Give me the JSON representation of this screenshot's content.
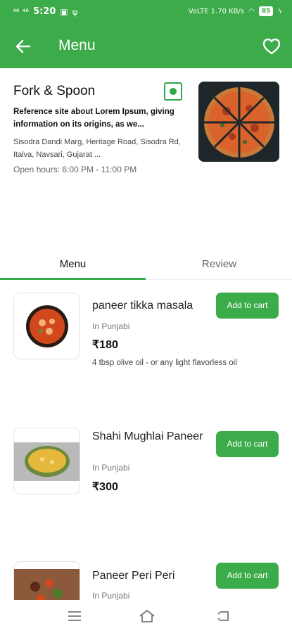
{
  "status_bar": {
    "left_icons": "⁴⁶ ⁴⁶",
    "time": "5:20",
    "right_text": "VoLTE 1.70 KB/s",
    "battery": "85",
    "colors": {
      "bg": "#3cab49"
    }
  },
  "app_bar": {
    "back_icon": "arrow-left-icon",
    "title": "Menu",
    "favorite_icon": "heart-outline-icon"
  },
  "restaurant": {
    "name": "Fork & Spoon",
    "veg_indicator": "veg-icon",
    "description": "Reference site about Lorem Ipsum, giving information on its origins, as we...",
    "address": "Sisodra Dandi Marg, Heritage Road, Sisodra Rd, Italva, Navsari, Gujarat ...",
    "hours": "Open hours: 6:00 PM - 11:00 PM"
  },
  "tabs": [
    {
      "label": "Menu",
      "active": true
    },
    {
      "label": "Review",
      "active": false
    }
  ],
  "menu_items": [
    {
      "name": "paneer tikka masala",
      "cuisine": "In Punjabi",
      "price": "₹180",
      "note": "4 tbsp olive oil - or any light flavorless oil",
      "button": "Add to cart"
    },
    {
      "name": "Shahi Mughlai Paneer",
      "cuisine": "In Punjabi",
      "price": "₹300",
      "note": "",
      "button": "Add to cart"
    },
    {
      "name": "Paneer Peri Peri",
      "cuisine": "In Punjabi",
      "price": "",
      "note": "",
      "button": "Add to cart"
    }
  ],
  "nav_bar": {
    "icons": [
      "menu-icon",
      "home-icon",
      "back-icon"
    ]
  },
  "colors": {
    "accent": "#3cab49",
    "veg": "#2fa84a"
  }
}
